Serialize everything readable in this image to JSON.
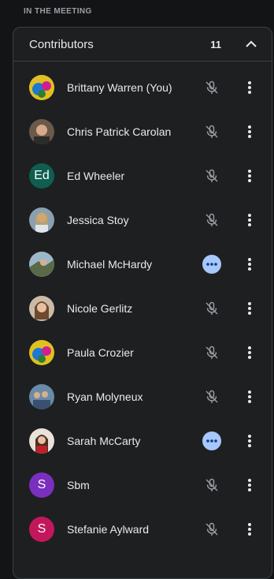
{
  "section_label": "IN THE MEETING",
  "panel": {
    "title": "Contributors",
    "count": "11"
  },
  "colors": {
    "speaking": "#a8c7fa",
    "avatar_ed": "#0f5e4f",
    "avatar_sbm": "#7b2fbf",
    "avatar_stefanie": "#c2185b"
  },
  "participants": [
    {
      "name": "Brittany Warren (You)",
      "avatar": "photo",
      "status": "muted"
    },
    {
      "name": "Chris Patrick Carolan",
      "avatar": "photo",
      "status": "muted"
    },
    {
      "name": "Ed Wheeler",
      "avatar": "Ed",
      "status": "muted"
    },
    {
      "name": "Jessica Stoy",
      "avatar": "photo",
      "status": "muted"
    },
    {
      "name": "Michael McHardy",
      "avatar": "photo",
      "status": "more-indicator"
    },
    {
      "name": "Nicole Gerlitz",
      "avatar": "photo",
      "status": "muted"
    },
    {
      "name": "Paula Crozier",
      "avatar": "photo",
      "status": "muted"
    },
    {
      "name": "Ryan Molyneux",
      "avatar": "photo",
      "status": "muted"
    },
    {
      "name": "Sarah McCarty",
      "avatar": "photo",
      "status": "more-indicator"
    },
    {
      "name": "Sbm",
      "avatar": "S",
      "status": "muted"
    },
    {
      "name": "Stefanie Aylward",
      "avatar": "S",
      "status": "muted"
    }
  ]
}
